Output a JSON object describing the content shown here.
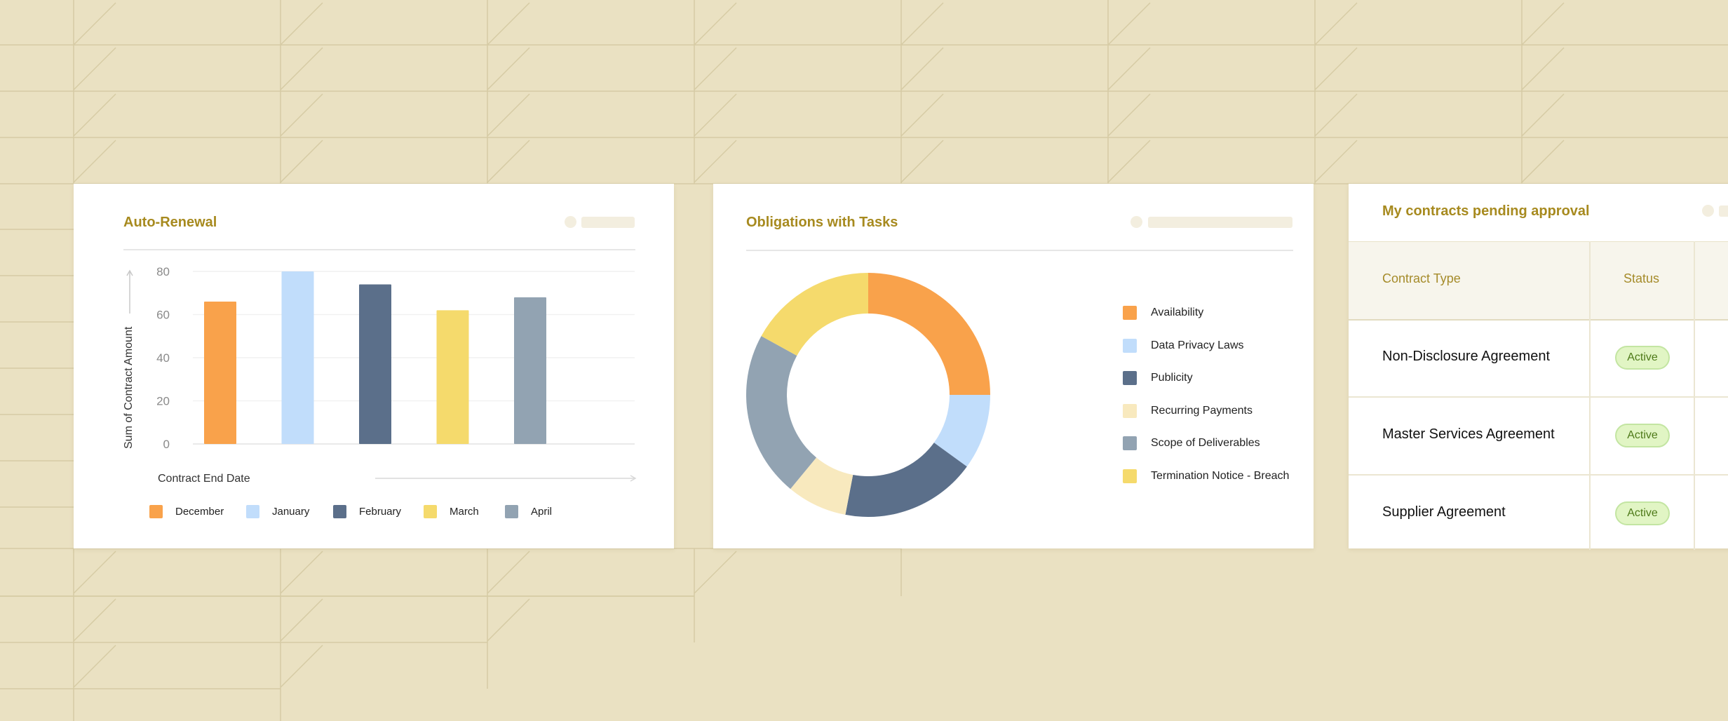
{
  "colors": {
    "background": "#EAE1C2",
    "accent_title": "#A78A1F",
    "december": "#F9A24B",
    "january": "#C1DDFB",
    "february": "#5B6F8A",
    "march": "#F5DA6C",
    "april": "#92A3B2",
    "recurring_payments": "#F8E9BE",
    "badge_bg": "#E1F5C4",
    "badge_text": "#4E7A19"
  },
  "auto_renewal": {
    "title": "Auto-Renewal",
    "ylabel": "Sum of Contract Amount",
    "xlabel": "Contract End Date"
  },
  "chart_data": [
    {
      "type": "bar",
      "title": "Auto-Renewal",
      "xlabel": "Contract End Date",
      "ylabel": "Sum of Contract Amount",
      "categories": [
        "December",
        "January",
        "February",
        "March",
        "April"
      ],
      "values": [
        66,
        80,
        74,
        62,
        68
      ],
      "yticks": [
        0,
        20,
        40,
        60,
        80
      ],
      "ylim": [
        0,
        80
      ],
      "grid": true,
      "legend": "bottom",
      "colors": [
        "#F9A24B",
        "#C1DDFB",
        "#5B6F8A",
        "#F5DA6C",
        "#92A3B2"
      ]
    },
    {
      "type": "pie",
      "title": "Obligations with Tasks",
      "donut": true,
      "categories": [
        "Availability",
        "Data Privacy Laws",
        "Publicity",
        "Recurring Payments",
        "Scope of Deliverables",
        "Termination Notice - Breach"
      ],
      "values": [
        25,
        10,
        18,
        8,
        22,
        17
      ],
      "legend": "right",
      "colors": [
        "#F9A24B",
        "#C1DDFB",
        "#5B6F8A",
        "#F8E9BE",
        "#92A3B2",
        "#F5DA6C"
      ]
    }
  ],
  "obligations": {
    "title": "Obligations with Tasks"
  },
  "pending": {
    "title": "My contracts pending approval",
    "headers": [
      "Contract Type",
      "Status"
    ],
    "rows": [
      {
        "contract_type": "Non-Disclosure Agreement",
        "status": "Active"
      },
      {
        "contract_type": "Master Services Agreement",
        "status": "Active"
      },
      {
        "contract_type": "Supplier Agreement",
        "status": "Active"
      }
    ]
  }
}
